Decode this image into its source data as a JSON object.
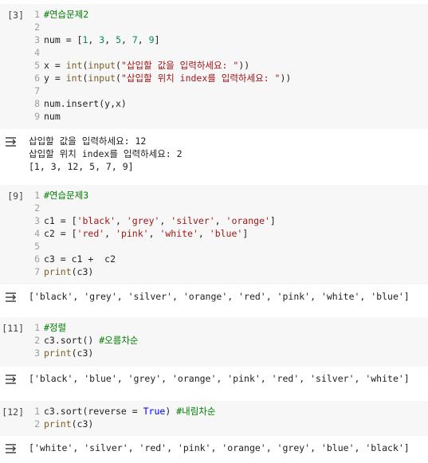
{
  "cells": [
    {
      "exec_count": "[3]",
      "lines": [
        [
          {
            "t": "#연습문제2",
            "c": "cm"
          }
        ],
        [],
        [
          {
            "t": "num = [",
            "c": ""
          },
          {
            "t": "1",
            "c": "num"
          },
          {
            "t": ", ",
            "c": ""
          },
          {
            "t": "3",
            "c": "num"
          },
          {
            "t": ", ",
            "c": ""
          },
          {
            "t": "5",
            "c": "num"
          },
          {
            "t": ", ",
            "c": ""
          },
          {
            "t": "7",
            "c": "num"
          },
          {
            "t": ", ",
            "c": ""
          },
          {
            "t": "9",
            "c": "num"
          },
          {
            "t": "]",
            "c": ""
          }
        ],
        [],
        [
          {
            "t": "x = ",
            "c": ""
          },
          {
            "t": "int",
            "c": "fn"
          },
          {
            "t": "(",
            "c": ""
          },
          {
            "t": "input",
            "c": "fn"
          },
          {
            "t": "(",
            "c": ""
          },
          {
            "t": "\"삽입할 값을 입력하세요: \"",
            "c": "str"
          },
          {
            "t": "))",
            "c": ""
          }
        ],
        [
          {
            "t": "y = ",
            "c": ""
          },
          {
            "t": "int",
            "c": "fn"
          },
          {
            "t": "(",
            "c": ""
          },
          {
            "t": "input",
            "c": "fn"
          },
          {
            "t": "(",
            "c": ""
          },
          {
            "t": "\"삽입할 위치 index를 입력하세요: \"",
            "c": "str"
          },
          {
            "t": "))",
            "c": ""
          }
        ],
        [],
        [
          {
            "t": "num.insert(y,x)",
            "c": ""
          }
        ],
        [
          {
            "t": "num",
            "c": ""
          }
        ]
      ],
      "output": [
        "삽입할 값을 입력하세요: 12",
        "삽입할 위치 index를 입력하세요: 2",
        "[1, 3, 12, 5, 7, 9]"
      ]
    },
    {
      "exec_count": "[9]",
      "lines": [
        [
          {
            "t": "#연습문제3",
            "c": "cm"
          }
        ],
        [],
        [
          {
            "t": "c1 = [",
            "c": ""
          },
          {
            "t": "'black'",
            "c": "str"
          },
          {
            "t": ", ",
            "c": ""
          },
          {
            "t": "'grey'",
            "c": "str"
          },
          {
            "t": ", ",
            "c": ""
          },
          {
            "t": "'silver'",
            "c": "str"
          },
          {
            "t": ", ",
            "c": ""
          },
          {
            "t": "'orange'",
            "c": "str"
          },
          {
            "t": "]",
            "c": ""
          }
        ],
        [
          {
            "t": "c2 = [",
            "c": ""
          },
          {
            "t": "'red'",
            "c": "str"
          },
          {
            "t": ", ",
            "c": ""
          },
          {
            "t": "'pink'",
            "c": "str"
          },
          {
            "t": ", ",
            "c": ""
          },
          {
            "t": "'white'",
            "c": "str"
          },
          {
            "t": ", ",
            "c": ""
          },
          {
            "t": "'blue'",
            "c": "str"
          },
          {
            "t": "]",
            "c": ""
          }
        ],
        [],
        [
          {
            "t": "c3 = c1 +  c2",
            "c": ""
          }
        ],
        [
          {
            "t": "print",
            "c": "fn"
          },
          {
            "t": "(c3)",
            "c": ""
          }
        ]
      ],
      "output": [
        "['black', 'grey', 'silver', 'orange', 'red', 'pink', 'white', 'blue']"
      ]
    },
    {
      "exec_count": "[11]",
      "lines": [
        [
          {
            "t": "#정렬",
            "c": "cm"
          }
        ],
        [
          {
            "t": "c3.sort() ",
            "c": ""
          },
          {
            "t": "#오름차순",
            "c": "cm"
          }
        ],
        [
          {
            "t": "print",
            "c": "fn"
          },
          {
            "t": "(c3)",
            "c": ""
          }
        ]
      ],
      "output": [
        "['black', 'blue', 'grey', 'orange', 'pink', 'red', 'silver', 'white']"
      ]
    },
    {
      "exec_count": "[12]",
      "lines": [
        [
          {
            "t": "c3.sort(reverse = ",
            "c": ""
          },
          {
            "t": "True",
            "c": "kw"
          },
          {
            "t": ") ",
            "c": ""
          },
          {
            "t": "#내림차순",
            "c": "cm"
          }
        ],
        [
          {
            "t": "print",
            "c": "fn"
          },
          {
            "t": "(c3)",
            "c": ""
          }
        ]
      ],
      "output": [
        "['white', 'silver', 'red', 'pink', 'orange', 'grey', 'blue', 'black']"
      ]
    }
  ]
}
